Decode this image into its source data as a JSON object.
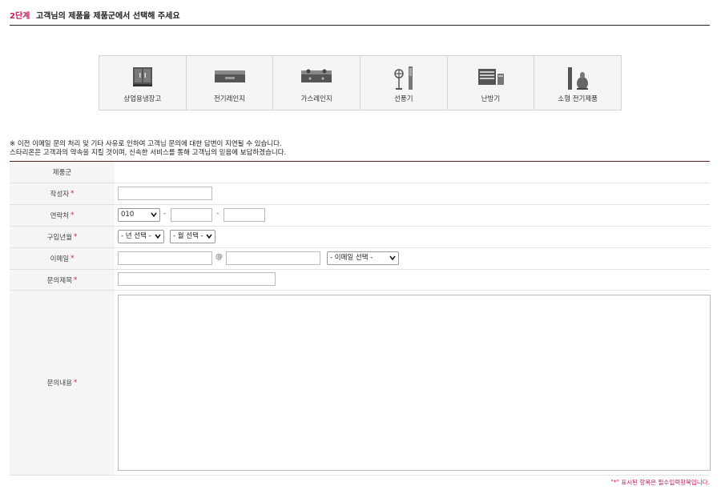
{
  "header": {
    "step": "2단계",
    "title": "고객님의 제품을 제품군에서 선택해 주세요"
  },
  "categories": [
    {
      "label": "상업용냉장고",
      "icon": "commercial-fridge-icon"
    },
    {
      "label": "전기레인지",
      "icon": "electric-range-icon"
    },
    {
      "label": "가스레인지",
      "icon": "gas-range-icon"
    },
    {
      "label": "선풍기",
      "icon": "fan-icon"
    },
    {
      "label": "난방기",
      "icon": "heater-icon"
    },
    {
      "label": "소형 전기제품",
      "icon": "small-appliance-icon"
    }
  ],
  "notice": {
    "line1": "※ 이전 이메일 문의 처리 및 기타 사유로 인하여 고객님 문의에 대한 답변이 지연될 수 있습니다.",
    "line2": "스타리온은 고객과의 약속을 지킬 것이며, 신속한 서비스를 통해 고객님의 믿음에 보답하겠습니다."
  },
  "form": {
    "product_group": {
      "label": "제품군",
      "value": ""
    },
    "author": {
      "label": "작성자",
      "required_mark": "*"
    },
    "contact": {
      "label": "연락처",
      "required_mark": "*",
      "prefix": "010",
      "sep": "-"
    },
    "purchase": {
      "label": "구입년월",
      "required_mark": "*",
      "year": "- 년 선택 -",
      "month": "- 월 선택 -"
    },
    "email": {
      "label": "이메일",
      "required_mark": "*",
      "at": "@",
      "domain_select": "- 이메일 선택 -"
    },
    "subject": {
      "label": "문의제목",
      "required_mark": "*"
    },
    "content": {
      "label": "문의내용",
      "required_mark": "*"
    }
  },
  "footnote": "\"*\" 표시된 항목은 필수입력항목입니다.",
  "colors": {
    "accent": "#c6175f",
    "divider": "#6b1b1b",
    "label_bg": "#f5f5f5"
  }
}
